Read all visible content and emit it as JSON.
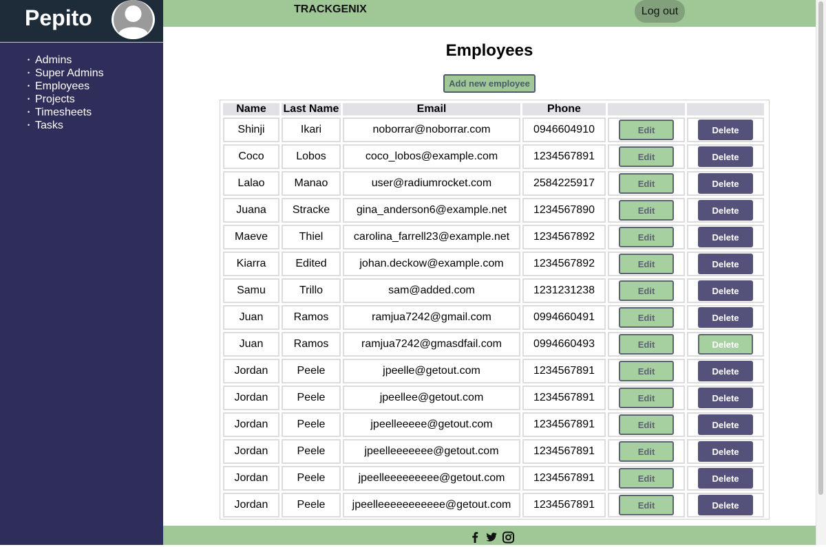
{
  "sidebar": {
    "user_name": "Pepito",
    "nav": [
      "Admins",
      "Super Admins",
      "Employees",
      "Projects",
      "Timesheets",
      "Tasks"
    ]
  },
  "header": {
    "brand": "TRACKGENIX",
    "logout_label": "Log out"
  },
  "main": {
    "title": "Employees",
    "add_button_label": "Add new employee",
    "table": {
      "columns": [
        "Name",
        "Last Name",
        "Email",
        "Phone",
        "",
        ""
      ],
      "edit_label": "Edit",
      "delete_label": "Delete",
      "rows": [
        {
          "name": "Shinji",
          "last_name": "Ikari",
          "email": "noborrar@noborrar.com",
          "phone": "0946604910"
        },
        {
          "name": "Coco",
          "last_name": "Lobos",
          "email": "coco_lobos@example.com",
          "phone": "1234567891"
        },
        {
          "name": "Lalao",
          "last_name": "Manao",
          "email": "user@radiumrocket.com",
          "phone": "2584225917"
        },
        {
          "name": "Juana",
          "last_name": "Stracke",
          "email": "gina_anderson6@example.net",
          "phone": "1234567890"
        },
        {
          "name": "Maeve",
          "last_name": "Thiel",
          "email": "carolina_farrell23@example.net",
          "phone": "1234567892"
        },
        {
          "name": "Kiarra",
          "last_name": "Edited",
          "email": "johan.deckow@example.com",
          "phone": "1234567892"
        },
        {
          "name": "Samu",
          "last_name": "Trillo",
          "email": "sam@added.com",
          "phone": "1231231238"
        },
        {
          "name": "Juan",
          "last_name": "Ramos",
          "email": "ramjua7242@gmail.com",
          "phone": "0994660491"
        },
        {
          "name": "Juan",
          "last_name": "Ramos",
          "email": "ramjua7242@gmasdfail.com",
          "phone": "0994660493"
        },
        {
          "name": "Jordan",
          "last_name": "Peele",
          "email": "jpeelle@getout.com",
          "phone": "1234567891"
        },
        {
          "name": "Jordan",
          "last_name": "Peele",
          "email": "jpeellee@getout.com",
          "phone": "1234567891"
        },
        {
          "name": "Jordan",
          "last_name": "Peele",
          "email": "jpeelleeeee@getout.com",
          "phone": "1234567891"
        },
        {
          "name": "Jordan",
          "last_name": "Peele",
          "email": "jpeelleeeeeee@getout.com",
          "phone": "1234567891"
        },
        {
          "name": "Jordan",
          "last_name": "Peele",
          "email": "jpeelleeeeeeeee@getout.com",
          "phone": "1234567891"
        },
        {
          "name": "Jordan",
          "last_name": "Peele",
          "email": "jpeelleeeeeeeeeee@getout.com",
          "phone": "1234567891"
        }
      ],
      "hovered_delete_row": 8
    }
  },
  "footer": {
    "icons": [
      "facebook-icon",
      "twitter-icon",
      "instagram-icon"
    ]
  },
  "colors": {
    "sidebar_bg": "#2f2d59",
    "sidebar_header_bg": "#1e2b38",
    "accent_green": "#9fc896",
    "delete_bg": "#54527a"
  }
}
